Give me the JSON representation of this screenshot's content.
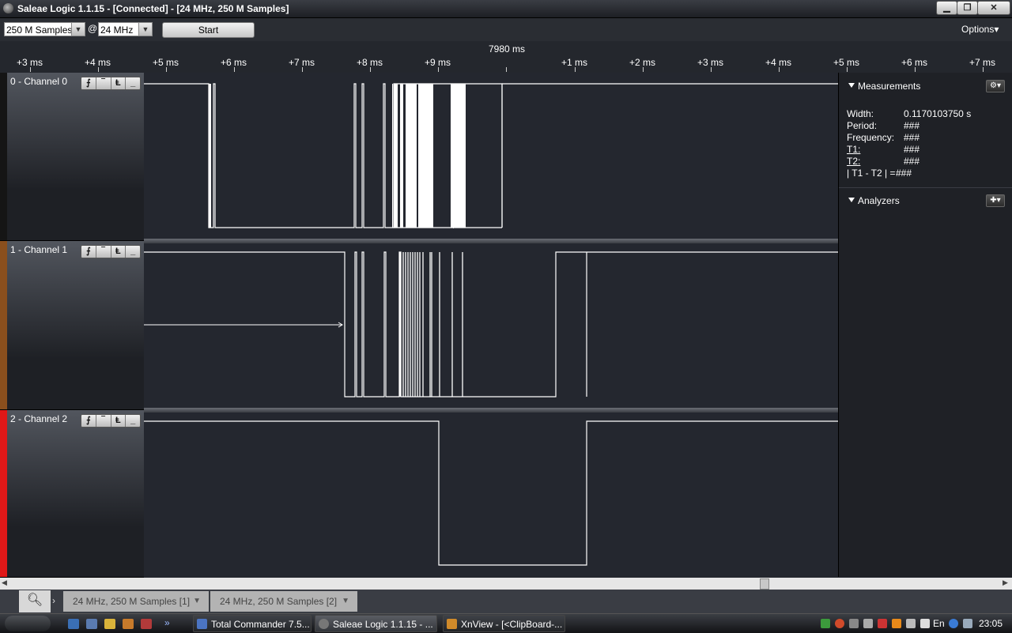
{
  "window": {
    "title": "Saleae Logic 1.1.15 - [Connected] - [24 MHz, 250 M Samples]"
  },
  "toolbar": {
    "samples_value": "250 M Samples",
    "at_sign": "@",
    "rate_value": "24 MHz",
    "start_label": "Start",
    "options_label": "Options▾"
  },
  "ruler": {
    "center_label": "7980 ms",
    "ticks": [
      "+3 ms",
      "+4 ms",
      "+5 ms",
      "+6 ms",
      "+7 ms",
      "+8 ms",
      "+9 ms",
      "+1 ms",
      "+2 ms",
      "+3 ms",
      "+4 ms",
      "+5 ms",
      "+6 ms",
      "+7 ms"
    ]
  },
  "channels": [
    {
      "label": "0 - Channel 0",
      "color": "#1a1a1a"
    },
    {
      "label": "1 - Channel 1",
      "color": "#8a4f1d"
    },
    {
      "label": "2 - Channel 2",
      "color": "#e01818"
    }
  ],
  "trigger_buttons": [
    "⨍",
    "‾",
    "Ⱡ",
    "_"
  ],
  "measurements": {
    "title": "Measurements",
    "rows": [
      {
        "label": "Width:",
        "value": "0.1170103750 s"
      },
      {
        "label": "Period:",
        "value": "###"
      },
      {
        "label": "Frequency:",
        "value": "###"
      },
      {
        "label": "T1:",
        "value": "###"
      },
      {
        "label": "T2:",
        "value": "###"
      },
      {
        "label": "| T1 - T2 | =",
        "value": "###"
      }
    ]
  },
  "analyzers": {
    "title": "Analyzers"
  },
  "tabs": {
    "tab1": "24 MHz, 250 M Samples [1]",
    "tab2": "24 MHz, 250 M Samples [2]"
  },
  "taskbar": {
    "items": [
      "Total Commander 7.5...",
      "Saleae Logic 1.1.15 - ...",
      "XnView - [<ClipBoard-..."
    ],
    "language": "En",
    "clock": "23:05"
  }
}
